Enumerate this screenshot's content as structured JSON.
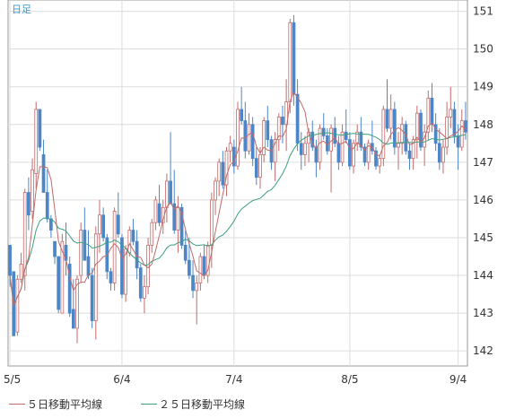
{
  "chart_data": {
    "type": "candlestick",
    "period_label": "日足",
    "x_tick_labels": [
      "5/5",
      "6/4",
      "7/4",
      "8/5",
      "9/4"
    ],
    "x_tick_index": [
      0,
      30,
      60,
      91,
      120
    ],
    "ylim": [
      141.6,
      151.3
    ],
    "y_ticks": [
      142,
      143,
      144,
      145,
      146,
      147,
      148,
      149,
      150,
      151
    ],
    "grid": true,
    "legend_position": "bottom",
    "legend": [
      {
        "name": "５日移動平均線",
        "color": "#c46a6a"
      },
      {
        "name": "２５日移動平均線",
        "color": "#3aa07e"
      }
    ],
    "colors": {
      "up_body": "#ffffff",
      "up_border": "#c46a6a",
      "down_body": "#4d86c6",
      "down_border": "#4d86c6",
      "ma5": "#c46a6a",
      "ma25": "#3aa07e",
      "grid": "#dddddd",
      "axis_text": "#333333",
      "period_label": "#3399cc"
    },
    "ohlc": [
      [
        144.8,
        144.8,
        143.7,
        144.0
      ],
      [
        144.1,
        144.0,
        142.4,
        142.4
      ],
      [
        142.5,
        144.0,
        142.4,
        143.9
      ],
      [
        143.9,
        144.6,
        143.8,
        144.3
      ],
      [
        144.0,
        146.3,
        143.6,
        146.2
      ],
      [
        146.2,
        146.6,
        145.2,
        145.6
      ],
      [
        145.7,
        147.1,
        145.5,
        146.8
      ],
      [
        146.7,
        148.6,
        146.3,
        148.4
      ],
      [
        148.4,
        148.4,
        147.3,
        147.4
      ],
      [
        147.2,
        147.6,
        146.2,
        146.2
      ],
      [
        146.2,
        146.8,
        145.4,
        145.5
      ],
      [
        145.5,
        145.6,
        145.0,
        145.2
      ],
      [
        144.9,
        144.9,
        144.3,
        144.5
      ],
      [
        144.5,
        144.5,
        143.0,
        143.1
      ],
      [
        143.0,
        145.1,
        143.0,
        144.9
      ],
      [
        144.8,
        145.4,
        144.0,
        144.4
      ],
      [
        144.3,
        144.5,
        142.9,
        143.0
      ],
      [
        143.1,
        143.9,
        142.6,
        142.6
      ],
      [
        142.6,
        144.0,
        142.2,
        143.9
      ],
      [
        144.0,
        145.4,
        143.8,
        145.2
      ],
      [
        145.2,
        145.8,
        144.4,
        144.4
      ],
      [
        144.5,
        145.2,
        143.9,
        144.0
      ],
      [
        144.0,
        144.2,
        142.6,
        142.8
      ],
      [
        142.8,
        145.3,
        142.3,
        145.1
      ],
      [
        145.1,
        146.0,
        144.6,
        145.6
      ],
      [
        145.6,
        145.8,
        144.9,
        145.0
      ],
      [
        145.0,
        145.1,
        143.9,
        144.1
      ],
      [
        144.1,
        144.2,
        143.6,
        143.8
      ],
      [
        143.8,
        145.8,
        143.6,
        145.7
      ],
      [
        145.6,
        146.2,
        145.0,
        145.1
      ],
      [
        145.0,
        145.1,
        143.4,
        143.5
      ],
      [
        143.5,
        144.8,
        143.3,
        144.7
      ],
      [
        144.6,
        145.3,
        144.5,
        145.2
      ],
      [
        145.2,
        145.5,
        144.8,
        144.9
      ],
      [
        144.9,
        145.2,
        143.9,
        144.2
      ],
      [
        144.2,
        144.3,
        143.3,
        143.4
      ],
      [
        143.4,
        144.0,
        143.0,
        143.7
      ],
      [
        143.7,
        145.0,
        143.5,
        144.8
      ],
      [
        144.8,
        145.5,
        144.6,
        145.4
      ],
      [
        145.4,
        146.1,
        145.2,
        146.0
      ],
      [
        145.9,
        146.4,
        145.3,
        145.4
      ],
      [
        145.4,
        146.0,
        145.1,
        145.8
      ],
      [
        145.8,
        146.7,
        145.4,
        146.5
      ],
      [
        146.5,
        147.8,
        145.9,
        145.9
      ],
      [
        145.9,
        146.8,
        145.1,
        145.2
      ],
      [
        145.2,
        146.1,
        144.6,
        145.8
      ],
      [
        145.8,
        145.9,
        144.7,
        144.8
      ],
      [
        144.8,
        145.2,
        144.3,
        144.4
      ],
      [
        144.4,
        145.0,
        143.9,
        144.0
      ],
      [
        144.0,
        144.4,
        143.4,
        143.6
      ],
      [
        143.6,
        144.0,
        142.7,
        143.8
      ],
      [
        143.8,
        144.6,
        143.6,
        144.5
      ],
      [
        144.5,
        144.8,
        143.9,
        144.0
      ],
      [
        144.0,
        144.9,
        143.8,
        144.8
      ],
      [
        144.8,
        146.2,
        144.2,
        146.0
      ],
      [
        146.0,
        146.6,
        145.6,
        146.5
      ],
      [
        146.5,
        147.1,
        146.1,
        147.0
      ],
      [
        147.0,
        147.3,
        146.3,
        146.4
      ],
      [
        146.4,
        147.4,
        146.1,
        147.3
      ],
      [
        147.3,
        147.7,
        147.0,
        147.5
      ],
      [
        147.4,
        147.6,
        146.7,
        146.9
      ],
      [
        146.9,
        148.6,
        146.8,
        148.4
      ],
      [
        148.4,
        149.0,
        148.0,
        148.1
      ],
      [
        148.1,
        148.6,
        147.1,
        147.3
      ],
      [
        147.3,
        148.3,
        147.2,
        148.0
      ],
      [
        148.0,
        148.2,
        146.9,
        147.1
      ],
      [
        147.1,
        147.4,
        146.4,
        146.6
      ],
      [
        146.6,
        147.4,
        146.3,
        147.2
      ],
      [
        147.2,
        148.2,
        147.0,
        148.1
      ],
      [
        148.1,
        148.5,
        147.4,
        147.6
      ],
      [
        147.6,
        147.7,
        146.8,
        147.0
      ],
      [
        147.0,
        147.8,
        146.5,
        147.6
      ],
      [
        147.6,
        148.3,
        147.3,
        148.2
      ],
      [
        148.2,
        148.5,
        147.5,
        148.0
      ],
      [
        148.0,
        149.2,
        147.3,
        148.6
      ],
      [
        148.6,
        150.8,
        148.3,
        150.7
      ],
      [
        150.7,
        150.9,
        148.5,
        148.8
      ],
      [
        148.8,
        149.2,
        147.3,
        147.5
      ],
      [
        147.5,
        147.8,
        146.8,
        147.2
      ],
      [
        147.2,
        147.7,
        146.9,
        147.5
      ],
      [
        147.5,
        147.9,
        147.0,
        147.8
      ],
      [
        147.8,
        148.1,
        147.3,
        147.4
      ],
      [
        147.4,
        147.6,
        146.6,
        147.0
      ],
      [
        147.0,
        148.0,
        146.8,
        147.9
      ],
      [
        147.9,
        148.3,
        147.6,
        147.7
      ],
      [
        147.7,
        147.9,
        147.2,
        147.3
      ],
      [
        147.3,
        148.0,
        146.2,
        147.9
      ],
      [
        147.9,
        148.2,
        147.4,
        147.5
      ],
      [
        147.5,
        147.7,
        146.8,
        147.0
      ],
      [
        147.0,
        148.0,
        146.9,
        147.8
      ],
      [
        147.8,
        148.4,
        147.5,
        147.6
      ],
      [
        147.6,
        147.8,
        146.8,
        146.9
      ],
      [
        146.9,
        147.6,
        146.7,
        147.5
      ],
      [
        147.5,
        148.0,
        147.3,
        147.8
      ],
      [
        147.8,
        148.2,
        147.3,
        147.4
      ],
      [
        147.4,
        147.5,
        146.9,
        147.0
      ],
      [
        147.0,
        147.6,
        146.8,
        147.5
      ],
      [
        147.5,
        148.1,
        147.2,
        147.3
      ],
      [
        147.3,
        147.4,
        146.8,
        146.9
      ],
      [
        146.9,
        147.2,
        146.7,
        147.1
      ],
      [
        147.1,
        148.5,
        146.9,
        148.4
      ],
      [
        148.4,
        149.2,
        147.8,
        147.9
      ],
      [
        147.9,
        148.8,
        147.6,
        148.4
      ],
      [
        148.4,
        148.6,
        147.2,
        147.4
      ],
      [
        147.4,
        147.8,
        146.8,
        147.5
      ],
      [
        147.5,
        148.2,
        147.2,
        148.0
      ],
      [
        148.0,
        148.1,
        147.2,
        147.3
      ],
      [
        147.3,
        147.5,
        146.8,
        147.1
      ],
      [
        147.1,
        147.7,
        146.8,
        147.6
      ],
      [
        147.6,
        148.5,
        147.1,
        148.3
      ],
      [
        148.3,
        148.4,
        147.3,
        147.4
      ],
      [
        147.4,
        148.0,
        146.9,
        147.8
      ],
      [
        147.8,
        148.9,
        147.6,
        148.7
      ],
      [
        148.7,
        149.1,
        147.8,
        148.0
      ],
      [
        148.0,
        148.3,
        147.3,
        147.5
      ],
      [
        147.5,
        147.9,
        146.8,
        147.0
      ],
      [
        147.0,
        147.6,
        146.7,
        147.4
      ],
      [
        147.4,
        148.6,
        147.2,
        148.2
      ],
      [
        148.2,
        149.0,
        147.9,
        148.4
      ],
      [
        148.4,
        148.6,
        147.5,
        147.7
      ],
      [
        147.7,
        148.0,
        146.8,
        147.4
      ],
      [
        147.4,
        148.4,
        147.3,
        148.1
      ],
      [
        148.1,
        148.6,
        147.6,
        147.8
      ]
    ]
  }
}
